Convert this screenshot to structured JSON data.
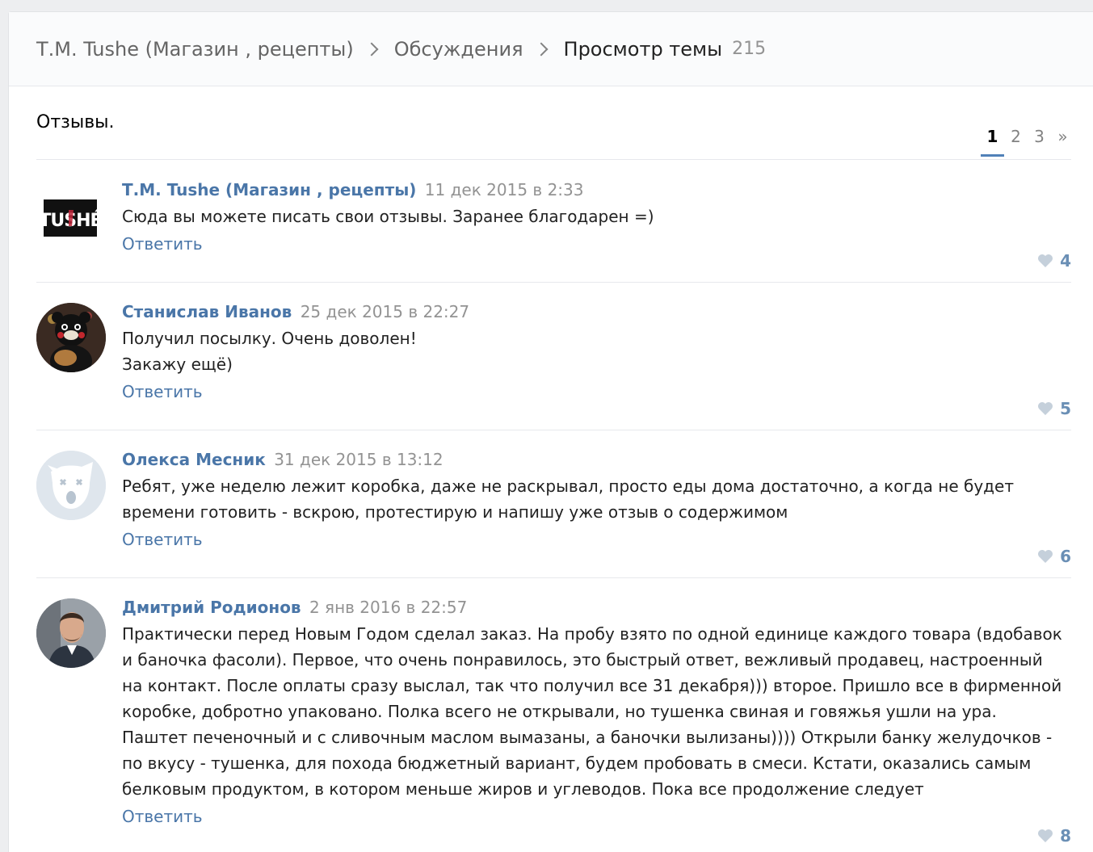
{
  "breadcrumb": {
    "group": "Т.М. Tushe (Магазин , рецепты)",
    "section": "Обсуждения",
    "current": "Просмотр темы",
    "count": "215"
  },
  "topic": {
    "title": "Отзывы."
  },
  "pager": {
    "pages": [
      "1",
      "2",
      "3"
    ],
    "next": "»",
    "active": "1"
  },
  "posts": [
    {
      "author": "Т.М. Tushe (Магазин , рецепты)",
      "date": "11 дек 2015 в 2:33",
      "text": [
        "Сюда вы можете писать свои отзывы. Заранее благодарен =)"
      ],
      "reply": "Ответить",
      "likes": "4",
      "avatar_logo": "TUSHÉ"
    },
    {
      "author": "Станислав Иванов",
      "date": "25 дек 2015 в 22:27",
      "text": [
        "Получил посылку. Очень доволен!",
        "Закажу ещё)"
      ],
      "reply": "Ответить",
      "likes": "5"
    },
    {
      "author": "Олекса Месник",
      "date": "31 дек 2015 в 13:12",
      "text": [
        "Ребят, уже неделю лежит коробка, даже не раскрывал, просто еды дома достаточно, а когда не будет времени готовить - вскрою, протестирую и напишу уже отзыв о содержимом"
      ],
      "reply": "Ответить",
      "likes": "6"
    },
    {
      "author": "Дмитрий Родионов",
      "date": "2 янв 2016 в 22:57",
      "text": [
        "Практически перед Новым Годом сделал заказ. На пробу взято по одной единице каждого товара (вдобавок и баночка фасоли). Первое, что очень понравилось, это быстрый ответ, вежливый продавец, настроенный на контакт. После оплаты сразу выслал, так что получил все 31 декабря))) второе. Пришло все в фирменной коробке, добротно упаковано. Полка всего не открывали, но тушенка свиная и говяжья ушли на ура. Паштет печеночный и с сливочным маслом вымазаны, а баночки вылизаны)))) Открыли банку желудочков - по вкусу - тушенка, для похода бюджетный вариант, будем пробовать в смеси. Кстати, оказались самым белковым продуктом, в котором меньше жиров и углеводов. Пока все продолжение следует"
      ],
      "reply": "Ответить",
      "likes": "8"
    }
  ],
  "colors": {
    "link": "#4a76a8",
    "like": "#6a8fb5",
    "date": "#939393",
    "accent": "#5181b8"
  }
}
